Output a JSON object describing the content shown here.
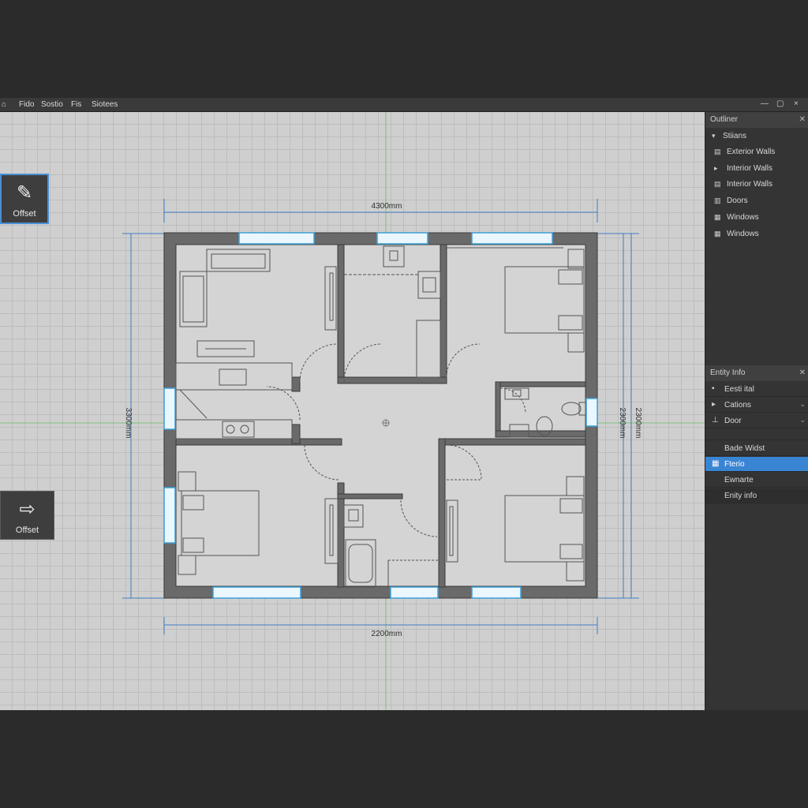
{
  "menubar": {
    "app_icon": "cube-icon",
    "items": [
      "Fido",
      "Sostio",
      "Fis",
      "Siotees"
    ],
    "window_buttons": [
      "—",
      "▢",
      "×"
    ]
  },
  "tools": {
    "offset_top": {
      "label": "Offset",
      "icon": "offset-eraser-icon"
    },
    "offset_bottom": {
      "label": "Offset",
      "icon": "offset-arrow-icon"
    }
  },
  "plan": {
    "dim_top": "4300mm",
    "dim_bottom": "2200mm",
    "dim_left": "3300mm",
    "dim_right_a": "2300mm",
    "dim_right_b": "2300mm"
  },
  "outliner": {
    "title": "Outliner",
    "items": [
      {
        "label": "Stiians",
        "icon": "section-icon"
      },
      {
        "label": "Exterior Walls",
        "icon": "wall-icon"
      },
      {
        "label": "Interior Walls",
        "icon": "wall-icon"
      },
      {
        "label": "Interior Walls",
        "icon": "wall-icon"
      },
      {
        "label": "Doors",
        "icon": "door-icon"
      },
      {
        "label": "Windows",
        "icon": "window-icon"
      },
      {
        "label": "Windows",
        "icon": "window-icon"
      }
    ]
  },
  "entity_info": {
    "title": "Entity Info",
    "rows": [
      {
        "label": "Eesti ital"
      },
      {
        "label": "Cations"
      },
      {
        "label": "Door"
      },
      {
        "label": "Bade Widst"
      },
      {
        "label": "Fterio"
      },
      {
        "label": "Ewnarte"
      },
      {
        "label": "Enity info"
      }
    ]
  },
  "colors": {
    "accent": "#3a84d4",
    "wall": "#6a6a6a",
    "window": "#8fd0f0",
    "dimension": "#3d7fc2",
    "axis": "#7fbf7f"
  }
}
